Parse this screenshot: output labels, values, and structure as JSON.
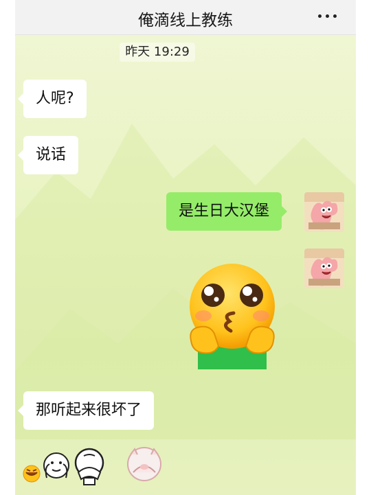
{
  "header": {
    "title": "俺滴线上教练",
    "menu_icon": "more-dots-icon"
  },
  "timestamp": "昨天 19:29",
  "messages": [
    {
      "side": "left",
      "text": "人呢?"
    },
    {
      "side": "left",
      "text": "说话"
    },
    {
      "side": "right",
      "text": "是生日大汉堡"
    },
    {
      "side": "right",
      "sticker": "kissing-face-sticker"
    },
    {
      "side": "left",
      "text": "那听起来很坏了"
    }
  ],
  "reaction_icons": [
    "laughing-face-icon",
    "stickman-hands-face-icon",
    "stickman-facepalm-icon",
    "pig-facepalm-icon"
  ],
  "colors": {
    "received_bubble": "#ffffff",
    "sent_bubble": "#95ec69",
    "background": "#e7f2c0"
  }
}
